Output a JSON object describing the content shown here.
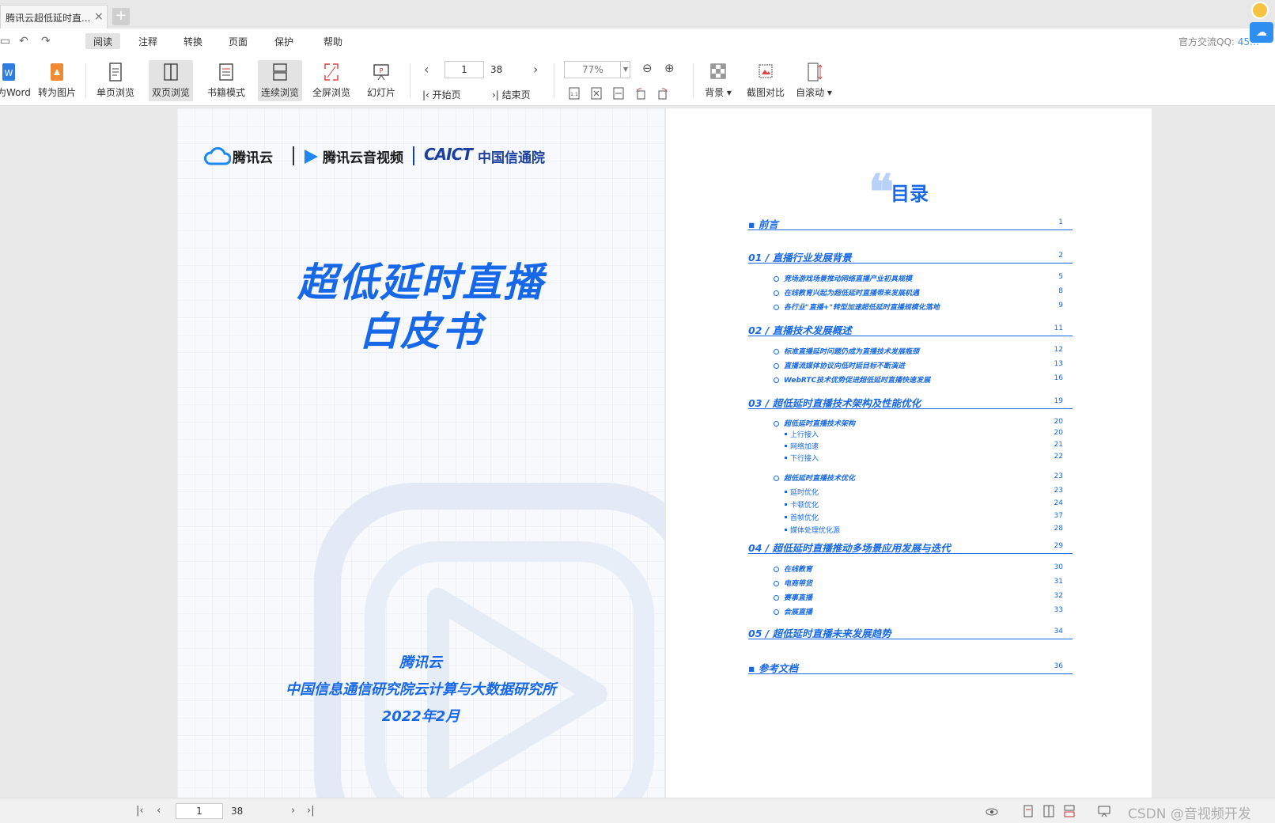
{
  "tab": {
    "title": "腾讯云超低延时直...",
    "close": "×",
    "add": "+"
  },
  "menu": {
    "items": [
      "阅读",
      "注释",
      "转换",
      "页面",
      "保护",
      "帮助"
    ],
    "active": "阅读"
  },
  "qq": {
    "label": "官方交流QQ:",
    "number": "45…"
  },
  "toolbar": {
    "to_word": "转为Word",
    "to_image": "转为图片",
    "single_page": "单页浏览",
    "double_page": "双页浏览",
    "book_mode": "书籍模式",
    "continuous": "连续浏览",
    "fullscreen": "全屏浏览",
    "slideshow": "幻灯片",
    "page_current": "1",
    "page_total": "38",
    "first_page": "开始页",
    "last_page": "结束页",
    "zoom": "77%",
    "background": "背景",
    "screenshot_compare": "截图对比",
    "auto_scroll": "自滚动"
  },
  "cover": {
    "logo_tencent_cloud": "腾讯云",
    "logo_tencent_av": "腾讯云音视频",
    "logo_caict": "CAICT",
    "logo_caict_cn": "中国信通院",
    "title_line1": "超低延时直播",
    "title_line2": "白皮书",
    "org1": "腾讯云",
    "org2": "中国信息通信研究院云计算与大数据研究所",
    "date": "2022年2月"
  },
  "toc": {
    "title": "目录",
    "preface": {
      "label": "▪ 前言",
      "page": "1"
    },
    "sections": [
      {
        "label": "01 /  直播行业发展背景",
        "page": "2",
        "subs": [
          {
            "label": "竞场游戏场景推动网络直播产业初具规模",
            "page": "5"
          },
          {
            "label": "在线教育兴起为超低延时直播带来发展机遇",
            "page": "8"
          },
          {
            "label": "各行业\"直播+\"转型加速超低延时直播规模化落地",
            "page": "9"
          }
        ]
      },
      {
        "label": "02 /  直播技术发展概述",
        "page": "11",
        "subs": [
          {
            "label": "标准直播延时问题仍成为直播技术发展瓶颈",
            "page": "12"
          },
          {
            "label": "直播流媒体协议向低时延目标不断演进",
            "page": "13"
          },
          {
            "label": "WebRTC技术优势促进超低延时直播快速发展",
            "page": "16"
          }
        ]
      },
      {
        "label": "03 /  超低延时直播技术架构及性能优化",
        "page": "19",
        "subs": [
          {
            "label": "超低延时直播技术架构",
            "page": "20",
            "items": [
              {
                "label": "上行接入",
                "page": "20"
              },
              {
                "label": "网络加速",
                "page": "21"
              },
              {
                "label": "下行接入",
                "page": "22"
              }
            ]
          },
          {
            "label": "超低延时直播技术优化",
            "page": "23",
            "items": [
              {
                "label": "延时优化",
                "page": "23"
              },
              {
                "label": "卡顿优化",
                "page": "24"
              },
              {
                "label": "首帧优化",
                "page": "37"
              },
              {
                "label": "媒体处理优化源",
                "page": "28"
              }
            ]
          }
        ]
      },
      {
        "label": "04 /  超低延时直播推动多场景应用发展与迭代",
        "page": "29",
        "subs": [
          {
            "label": "在线教育",
            "page": "30"
          },
          {
            "label": "电商带货",
            "page": "31"
          },
          {
            "label": "赛事直播",
            "page": "32"
          },
          {
            "label": "会展直播",
            "page": "33"
          }
        ]
      },
      {
        "label": "05 /  超低延时直播未来发展趋势",
        "page": "34",
        "subs": []
      }
    ],
    "references": {
      "label": "▪ 参考文档",
      "page": "36"
    }
  },
  "status": {
    "page_current": "1",
    "page_total": "38",
    "watermark": "CSDN @音视频开发"
  },
  "colors": {
    "accent": "#1768e8",
    "toolbar_active": "#e3e3e3",
    "caict": "#1a3f9e"
  }
}
